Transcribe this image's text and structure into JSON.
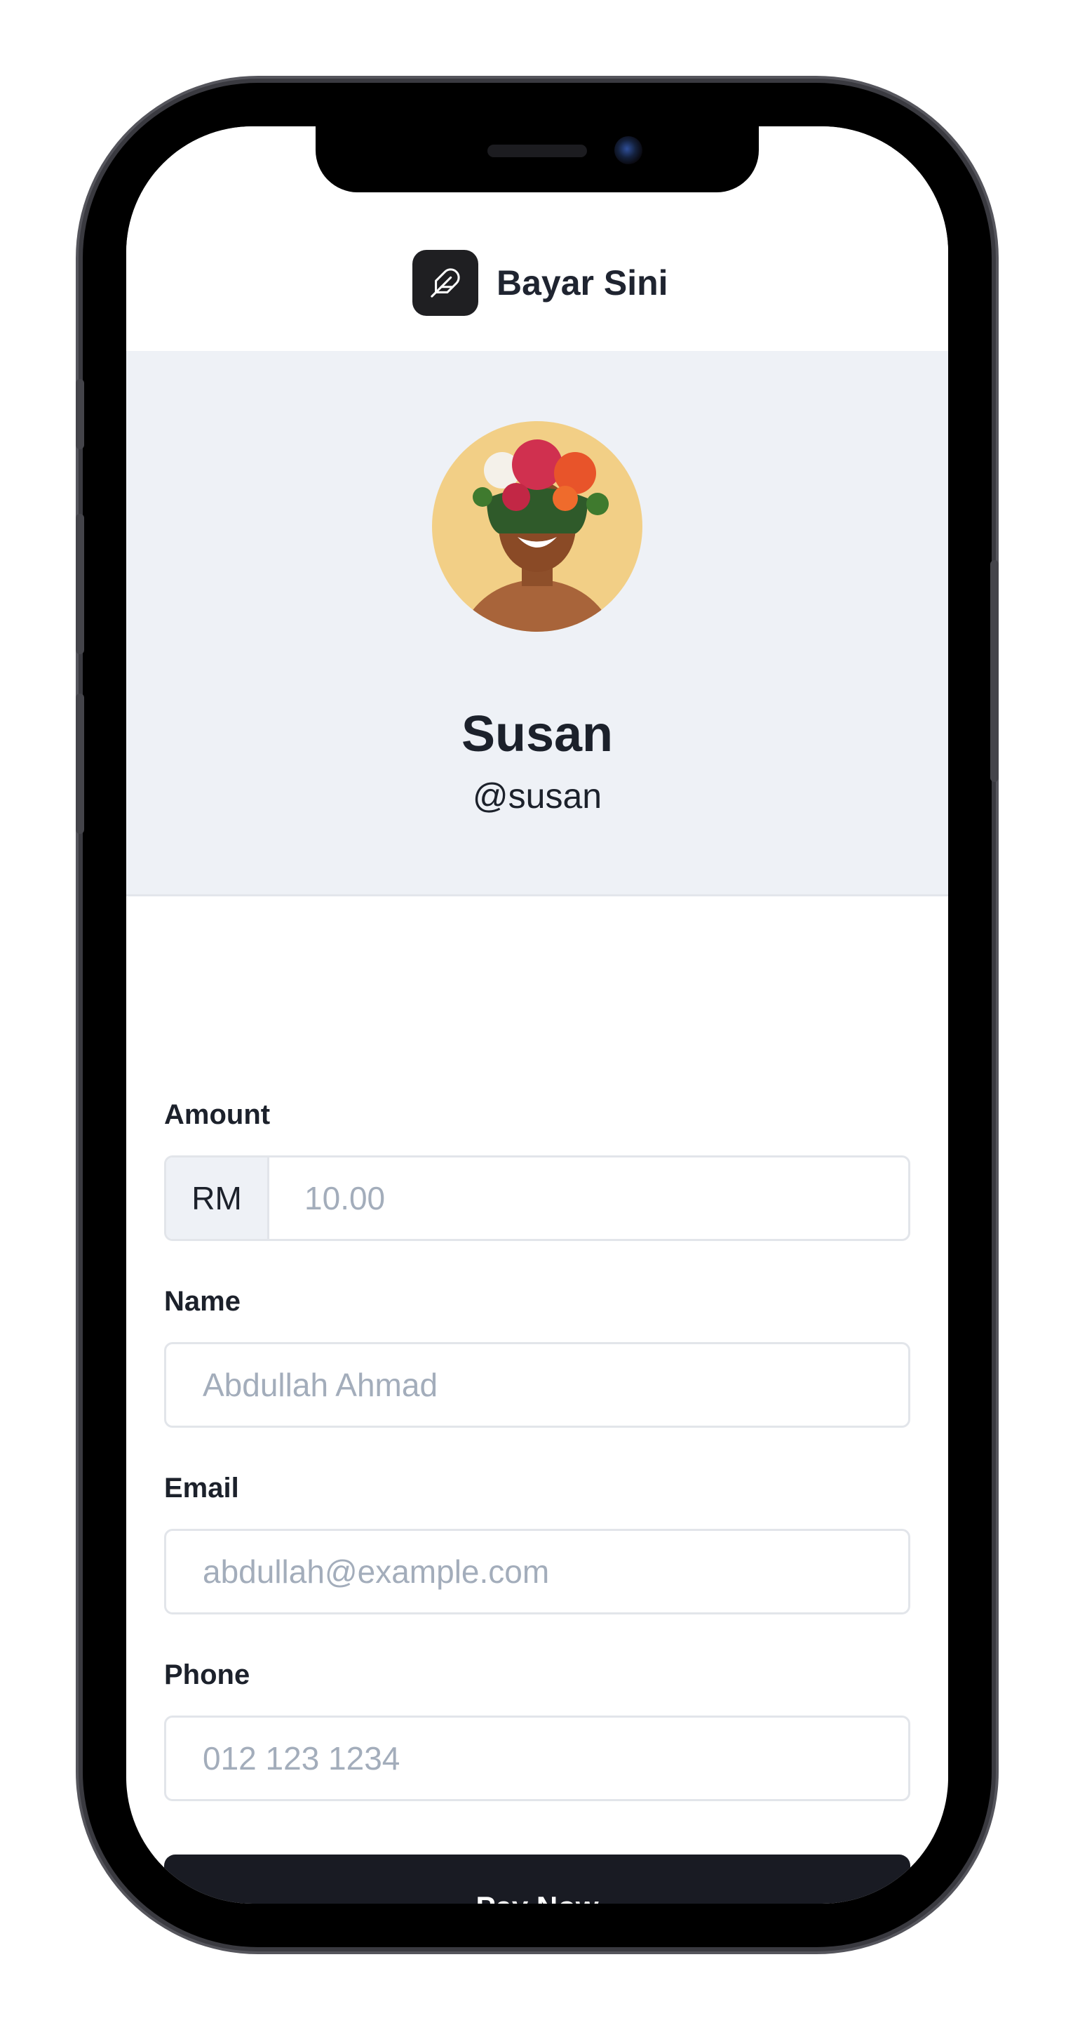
{
  "app": {
    "brand_name": "Bayar Sini"
  },
  "profile": {
    "name": "Susan",
    "handle": "@susan"
  },
  "form": {
    "amount": {
      "label": "Amount",
      "prefix": "RM",
      "placeholder": "10.00",
      "value": ""
    },
    "name": {
      "label": "Name",
      "placeholder": "Abdullah Ahmad",
      "value": ""
    },
    "email": {
      "label": "Email",
      "placeholder": "abdullah@example.com",
      "value": ""
    },
    "phone": {
      "label": "Phone",
      "placeholder": "012 123 1234",
      "value": ""
    },
    "submit_label": "Pay Now"
  },
  "icons": {
    "brand_logo": "feather-icon",
    "avatar": "woman-with-flower-crown-photo"
  },
  "colors": {
    "primary_button": "#191b23",
    "profile_background": "#eef1f6",
    "placeholder_text": "#a3adbb"
  }
}
